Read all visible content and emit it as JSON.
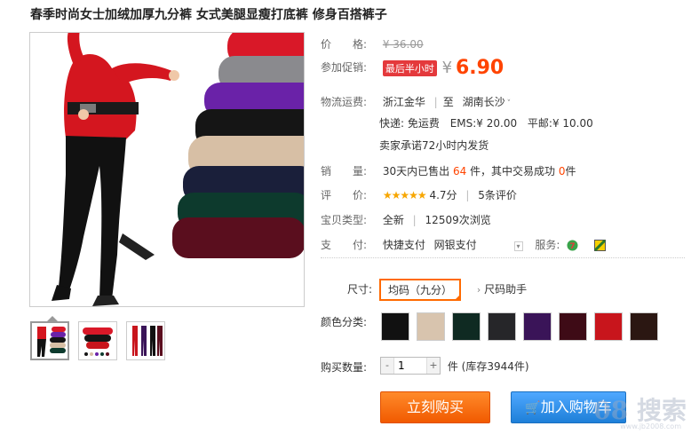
{
  "product": {
    "title": "春季时尚女士加绒加厚九分裤 女式美腿显瘦打底裤 修身百搭裤子"
  },
  "price": {
    "label": "价　　格:",
    "original": "¥ 36.00"
  },
  "promo": {
    "label": "参加促销:",
    "badge": "最后半小时",
    "yen": "¥",
    "price": "6.90"
  },
  "shipping": {
    "label": "物流运费:",
    "from": "浙江金华",
    "to_prefix": "至",
    "to": "湖南长沙",
    "express": "快递: 免运费",
    "ems": "EMS:¥ 20.00",
    "surface": "平邮:¥ 10.00",
    "promise": "卖家承诺72小时内发货"
  },
  "sales": {
    "label": "销　　量:",
    "prefix": "30天内已售出",
    "count": "64",
    "mid": "件，其中交易成功",
    "success": "0",
    "suffix": "件"
  },
  "rating": {
    "label": "评　　价:",
    "stars": "★★★★★",
    "score": "4.7分",
    "reviews": "5条评价"
  },
  "item_type": {
    "label": "宝贝类型:",
    "type": "全新",
    "views": "12509次浏览"
  },
  "payment": {
    "label": "支　　付:",
    "method1": "快捷支付",
    "method2": "网银支付",
    "service_label": "服务:"
  },
  "size": {
    "label": "尺寸:",
    "selected": "均码（九分）",
    "helper": "尺码助手"
  },
  "color": {
    "label": "颜色分类:",
    "options": [
      {
        "name": "black",
        "hex": "#111111"
      },
      {
        "name": "beige",
        "hex": "#d8c4ae"
      },
      {
        "name": "dark-green",
        "hex": "#0f2a22"
      },
      {
        "name": "charcoal",
        "hex": "#262629"
      },
      {
        "name": "purple",
        "hex": "#3a1458"
      },
      {
        "name": "wine",
        "hex": "#3e0b16"
      },
      {
        "name": "red",
        "hex": "#c8151c"
      },
      {
        "name": "brown",
        "hex": "#2b1712"
      }
    ]
  },
  "quantity": {
    "label": "购买数量:",
    "minus": "-",
    "value": "1",
    "plus": "+",
    "stock": "件 (库存3944件)"
  },
  "buttons": {
    "buy_now": "立刻购买",
    "add_to_cart": "加入购物车"
  },
  "watermark": {
    "logo": "08 搜索",
    "url": "www.jb2008.com"
  },
  "colors": {
    "accent": "#ff4400",
    "buy": "#f15a00",
    "cart": "#1e7fd8"
  }
}
